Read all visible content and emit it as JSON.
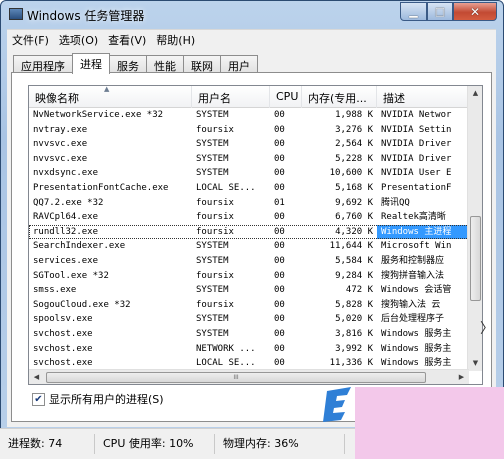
{
  "window": {
    "title": "Windows 任务管理器"
  },
  "menu": [
    "文件(F)",
    "选项(O)",
    "查看(V)",
    "帮助(H)"
  ],
  "tabs": [
    "应用程序",
    "进程",
    "服务",
    "性能",
    "联网",
    "用户"
  ],
  "active_tab": 1,
  "columns": [
    "映像名称",
    "用户名",
    "CPU",
    "内存(专用...",
    "描述"
  ],
  "rows": [
    {
      "name": "NvNetworkService.exe *32",
      "user": "SYSTEM",
      "cpu": "00",
      "mem": "1,988 K",
      "desc": "NVIDIA Networ"
    },
    {
      "name": "nvtray.exe",
      "user": "foursix",
      "cpu": "00",
      "mem": "3,276 K",
      "desc": "NVIDIA Settin"
    },
    {
      "name": "nvvsvc.exe",
      "user": "SYSTEM",
      "cpu": "00",
      "mem": "2,564 K",
      "desc": "NVIDIA Driver"
    },
    {
      "name": "nvvsvc.exe",
      "user": "SYSTEM",
      "cpu": "00",
      "mem": "5,228 K",
      "desc": "NVIDIA Driver"
    },
    {
      "name": "nvxdsync.exe",
      "user": "SYSTEM",
      "cpu": "00",
      "mem": "10,600 K",
      "desc": "NVIDIA User E"
    },
    {
      "name": "PresentationFontCache.exe",
      "user": "LOCAL SE...",
      "cpu": "00",
      "mem": "5,168 K",
      "desc": "PresentationF"
    },
    {
      "name": "QQ7.2.exe *32",
      "user": "foursix",
      "cpu": "01",
      "mem": "9,692 K",
      "desc": "腾讯QQ"
    },
    {
      "name": "RAVCpl64.exe",
      "user": "foursix",
      "cpu": "00",
      "mem": "6,760 K",
      "desc": "Realtek高清晰"
    },
    {
      "name": "rundll32.exe",
      "user": "foursix",
      "cpu": "00",
      "mem": "4,320 K",
      "desc": "Windows 主进程"
    },
    {
      "name": "SearchIndexer.exe",
      "user": "SYSTEM",
      "cpu": "00",
      "mem": "11,644 K",
      "desc": "Microsoft Win"
    },
    {
      "name": "services.exe",
      "user": "SYSTEM",
      "cpu": "00",
      "mem": "5,584 K",
      "desc": "服务和控制器应"
    },
    {
      "name": "SGTool.exe *32",
      "user": "foursix",
      "cpu": "00",
      "mem": "9,284 K",
      "desc": "搜狗拼音输入法"
    },
    {
      "name": "smss.exe",
      "user": "SYSTEM",
      "cpu": "00",
      "mem": "472 K",
      "desc": "Windows 会话管"
    },
    {
      "name": "SogouCloud.exe *32",
      "user": "foursix",
      "cpu": "00",
      "mem": "5,828 K",
      "desc": "搜狗输入法 云"
    },
    {
      "name": "spoolsv.exe",
      "user": "SYSTEM",
      "cpu": "00",
      "mem": "5,020 K",
      "desc": "后台处理程序子"
    },
    {
      "name": "svchost.exe",
      "user": "SYSTEM",
      "cpu": "00",
      "mem": "3,816 K",
      "desc": "Windows 服务主"
    },
    {
      "name": "svchost.exe",
      "user": "NETWORK ...",
      "cpu": "00",
      "mem": "3,992 K",
      "desc": "Windows 服务主"
    },
    {
      "name": "svchost.exe",
      "user": "LOCAL SE...",
      "cpu": "00",
      "mem": "11,336 K",
      "desc": "Windows 服务主"
    }
  ],
  "selected_row": 8,
  "show_all_users": {
    "label": "显示所有用户的进程(S)",
    "checked": true
  },
  "status": {
    "processes": "进程数: 74",
    "cpu": "CPU 使用率: 10%",
    "memory": "物理内存: 36%"
  },
  "hscroll_grip": "III"
}
